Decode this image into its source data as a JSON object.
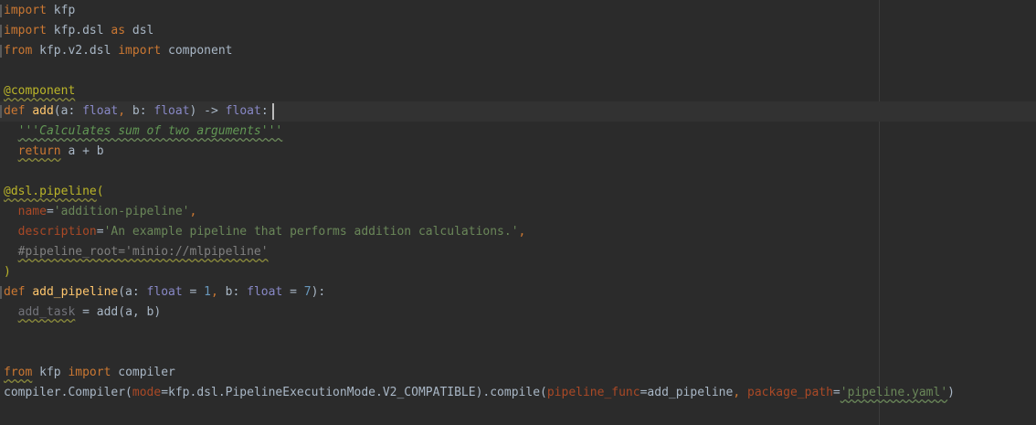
{
  "editor": {
    "lines": [
      [
        {
          "t": "import",
          "c": "kw"
        },
        {
          "t": " kfp",
          "c": "plain"
        }
      ],
      [
        {
          "t": "import",
          "c": "kw"
        },
        {
          "t": " kfp.dsl ",
          "c": "plain"
        },
        {
          "t": "as",
          "c": "kw"
        },
        {
          "t": " dsl",
          "c": "plain"
        }
      ],
      [
        {
          "t": "from",
          "c": "kw"
        },
        {
          "t": " kfp.v2.dsl ",
          "c": "plain"
        },
        {
          "t": "import",
          "c": "kw"
        },
        {
          "t": " component",
          "c": "plain"
        }
      ],
      [],
      [
        {
          "t": "@component",
          "c": "deco wavy"
        }
      ],
      [
        {
          "t": "def",
          "c": "kw"
        },
        {
          "t": " ",
          "c": "plain"
        },
        {
          "t": "add",
          "c": "fn"
        },
        {
          "t": "(a: ",
          "c": "plain"
        },
        {
          "t": "float",
          "c": "bi"
        },
        {
          "t": ", ",
          "c": "kw"
        },
        {
          "t": "b: ",
          "c": "plain"
        },
        {
          "t": "float",
          "c": "bi"
        },
        {
          "t": ") -> ",
          "c": "plain"
        },
        {
          "t": "float",
          "c": "bi"
        },
        {
          "t": ":",
          "c": "plain"
        }
      ],
      [
        {
          "t": "  ",
          "c": "plain"
        },
        {
          "t": "'''Calculates sum of two arguments'''",
          "c": "doc wavy-green"
        }
      ],
      [
        {
          "t": "  ",
          "c": "plain"
        },
        {
          "t": "return",
          "c": "kw wavy"
        },
        {
          "t": " a + b",
          "c": "plain"
        }
      ],
      [],
      [
        {
          "t": "@dsl.pipeline",
          "c": "deco wavy"
        },
        {
          "t": "(",
          "c": "deco"
        }
      ],
      [
        {
          "t": "  ",
          "c": "plain"
        },
        {
          "t": "name",
          "c": "param"
        },
        {
          "t": "=",
          "c": "plain"
        },
        {
          "t": "'addition-pipeline'",
          "c": "str"
        },
        {
          "t": ",",
          "c": "kw"
        }
      ],
      [
        {
          "t": "  ",
          "c": "plain"
        },
        {
          "t": "description",
          "c": "param"
        },
        {
          "t": "=",
          "c": "plain"
        },
        {
          "t": "'An example pipeline that performs addition calculations.'",
          "c": "str"
        },
        {
          "t": ",",
          "c": "kw"
        }
      ],
      [
        {
          "t": "  ",
          "c": "plain"
        },
        {
          "t": "#pipeline_root='minio://mlpipeline'",
          "c": "cmt wavy"
        }
      ],
      [
        {
          "t": ")",
          "c": "deco"
        }
      ],
      [
        {
          "t": "def",
          "c": "kw"
        },
        {
          "t": " ",
          "c": "plain"
        },
        {
          "t": "add_pipeline",
          "c": "fn"
        },
        {
          "t": "(a: ",
          "c": "plain"
        },
        {
          "t": "float",
          "c": "bi"
        },
        {
          "t": " = ",
          "c": "plain"
        },
        {
          "t": "1",
          "c": "num"
        },
        {
          "t": ", ",
          "c": "kw"
        },
        {
          "t": "b: ",
          "c": "plain"
        },
        {
          "t": "float",
          "c": "bi"
        },
        {
          "t": " = ",
          "c": "plain"
        },
        {
          "t": "7",
          "c": "num"
        },
        {
          "t": "):",
          "c": "plain"
        }
      ],
      [
        {
          "t": "  ",
          "c": "plain"
        },
        {
          "t": "add_task",
          "c": "unused wavy"
        },
        {
          "t": " = add(a, b)",
          "c": "plain"
        }
      ],
      [],
      [],
      [
        {
          "t": "from",
          "c": "kw wavy"
        },
        {
          "t": " kfp ",
          "c": "plain"
        },
        {
          "t": "import",
          "c": "kw"
        },
        {
          "t": " compiler",
          "c": "plain"
        }
      ],
      [
        {
          "t": "compiler.Compiler(",
          "c": "plain"
        },
        {
          "t": "mode",
          "c": "param"
        },
        {
          "t": "=kfp.dsl.PipelineExecutionMode.V2_COMPATIBLE).compile(",
          "c": "plain"
        },
        {
          "t": "pipeline_func",
          "c": "param"
        },
        {
          "t": "=add_pipeline",
          "c": "plain"
        },
        {
          "t": ", ",
          "c": "kw"
        },
        {
          "t": "package_path",
          "c": "param"
        },
        {
          "t": "=",
          "c": "plain"
        },
        {
          "t": "'pipeline.yaml'",
          "c": "str wavy-green"
        },
        {
          "t": ")",
          "c": "plain"
        }
      ]
    ]
  },
  "colors": {
    "background": "#2b2b2b",
    "current_line": "#323232",
    "keyword": "#cc7832",
    "decorator": "#bbb529",
    "function": "#ffc66d",
    "builtin": "#8888c6",
    "string": "#6a8759",
    "number": "#6897bb",
    "parameter": "#aa4926",
    "comment": "#808080"
  }
}
